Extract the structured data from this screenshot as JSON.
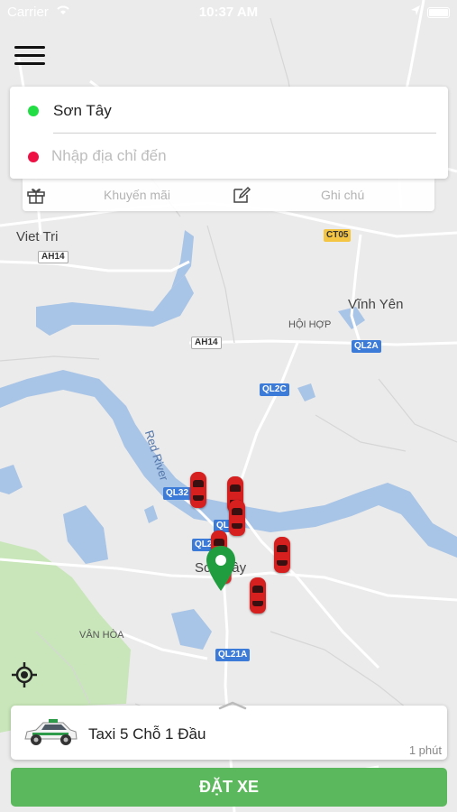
{
  "status_bar": {
    "carrier": "Carrier",
    "time": "10:37 AM"
  },
  "route": {
    "origin": "Sơn Tây",
    "origin_dot_color": "#22dd44",
    "destination_placeholder": "Nhập địa chỉ đến",
    "destination_dot_color": "#ee1144"
  },
  "options": {
    "promo_label": "Khuyến mãi",
    "note_label": "Ghi chú"
  },
  "map": {
    "places": {
      "viet_tri": "Viet Tri",
      "vinh_yen": "Vĩnh Yên",
      "hoi_hop": "HỘI HỢP",
      "red_river": "Red River",
      "van_hoa": "VÂN HÒA",
      "son_tay": "Sơn Tây"
    },
    "roads": {
      "ah14_a": "AH14",
      "ah14_b": "AH14",
      "ct05": "CT05",
      "ql2a": "QL2A",
      "ql2c": "QL2C",
      "ql32": "QL32",
      "ql2": "QL2",
      "ql21a": "QL21A"
    },
    "nearby_cars": 7
  },
  "vehicle": {
    "name": "Taxi 5 Chỗ 1 Đầu",
    "eta": "1 phút"
  },
  "book_button": "ĐẶT XE",
  "colors": {
    "accent": "#5cb85c",
    "car": "#d61f1f",
    "pin": "#1f9d3f",
    "water": "#a8c4e6",
    "park": "#c8e6b9"
  }
}
